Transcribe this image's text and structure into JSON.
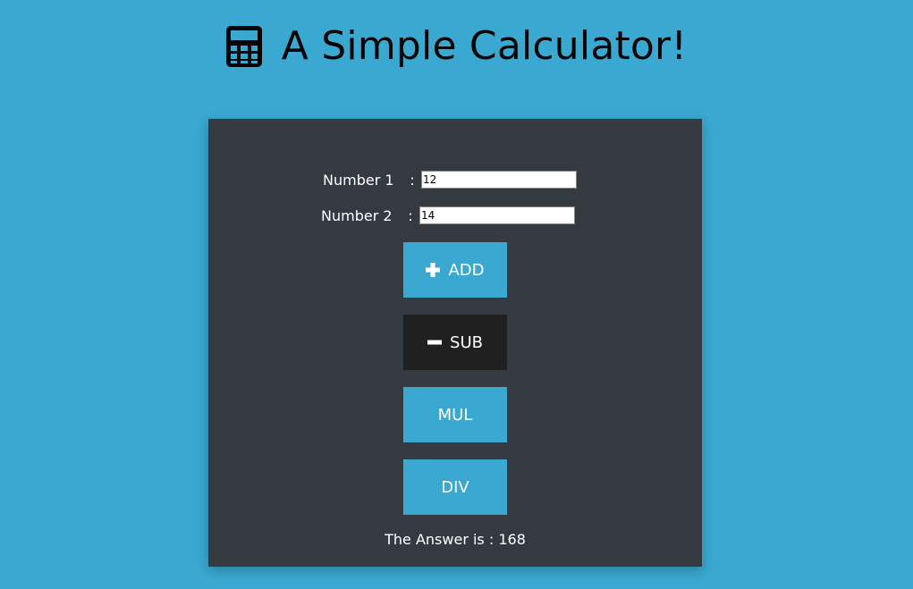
{
  "header": {
    "icon": "calculator-icon",
    "title": "A Simple Calculator!"
  },
  "form": {
    "number1": {
      "label": "Number 1",
      "separator": ":",
      "value": "12"
    },
    "number2": {
      "label": "Number 2",
      "separator": ":",
      "value": "14"
    }
  },
  "buttons": {
    "add": {
      "label": "ADD",
      "icon": "plus-icon"
    },
    "sub": {
      "label": "SUB",
      "icon": "minus-icon"
    },
    "mul": {
      "label": "MUL"
    },
    "div": {
      "label": "DIV"
    }
  },
  "result": {
    "text": "The Answer is : 168"
  },
  "colors": {
    "background": "#3aa8d0",
    "panel": "#353940",
    "button_primary": "#3aa8d0",
    "button_active": "#202020"
  }
}
